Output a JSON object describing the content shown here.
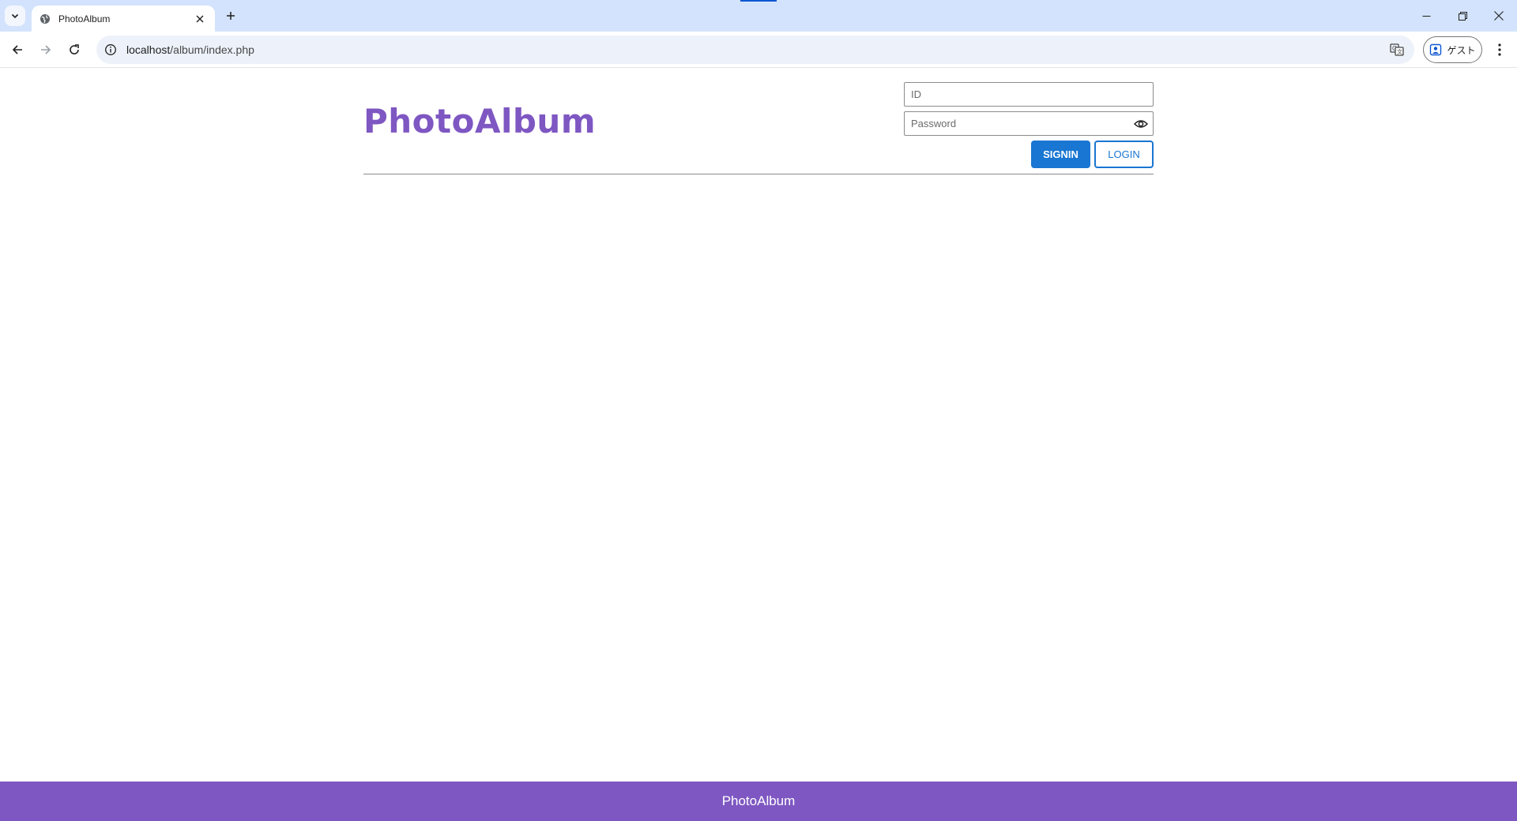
{
  "browser": {
    "tab": {
      "title": "PhotoAlbum"
    },
    "address": {
      "host": "localhost",
      "path": "/album/index.php"
    },
    "profile": {
      "label": "ゲスト"
    },
    "icons": {
      "tab_search": "chevron-down-icon",
      "favicon": "globe-icon",
      "tab_close": "close-icon",
      "new_tab": "plus-icon",
      "back": "arrow-left-icon",
      "forward": "arrow-right-icon",
      "reload": "reload-icon",
      "site_info": "info-icon",
      "translate": "translate-icon",
      "menu": "kebab-menu-icon"
    }
  },
  "header": {
    "site_title": "PhotoAlbum"
  },
  "login": {
    "id_placeholder": "ID",
    "password_placeholder": "Password",
    "signin_label": "SIGNIN",
    "login_label": "LOGIN"
  },
  "footer": {
    "text": "PhotoAlbum"
  },
  "colors": {
    "brand_purple": "#7e57c2",
    "primary_blue": "#1976d2",
    "tabstrip": "#d3e3fd"
  }
}
